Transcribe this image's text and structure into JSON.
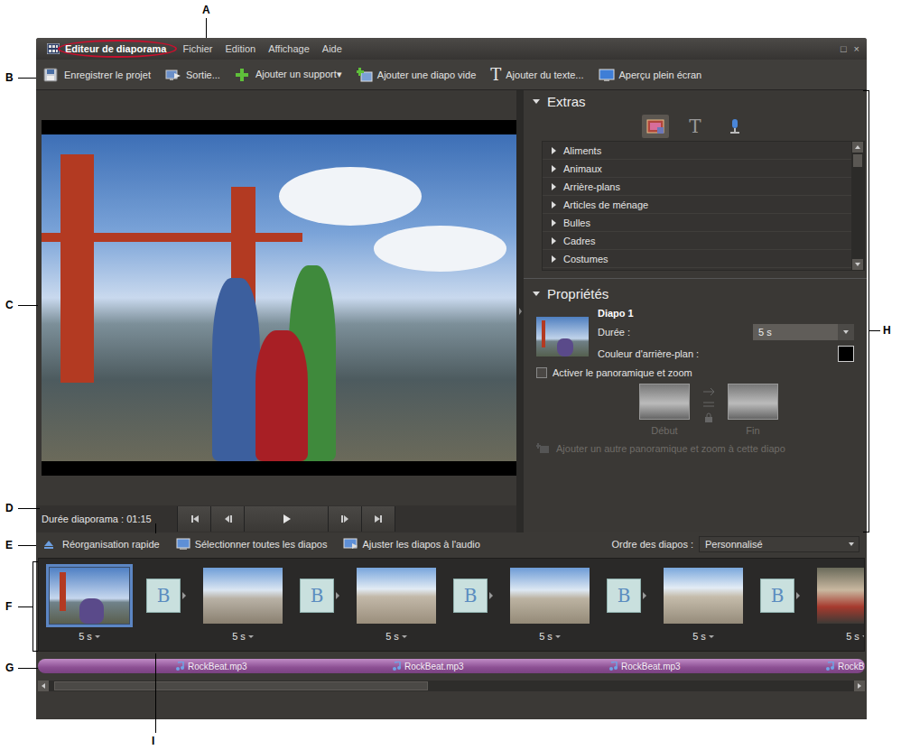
{
  "callouts": [
    {
      "letter": "A"
    },
    {
      "letter": "B"
    },
    {
      "letter": "C"
    },
    {
      "letter": "D"
    },
    {
      "letter": "E"
    },
    {
      "letter": "F"
    },
    {
      "letter": "G"
    },
    {
      "letter": "H"
    },
    {
      "letter": "I"
    }
  ],
  "window": {
    "title": "Editeur de diaporama",
    "controls": [
      "□",
      "×"
    ]
  },
  "menu": [
    "Fichier",
    "Edition",
    "Affichage",
    "Aide"
  ],
  "toolbar": [
    {
      "label": "Enregistrer le projet",
      "kind": "save"
    },
    {
      "label": "Sortie...",
      "kind": "output"
    },
    {
      "label": "Ajouter un support▾",
      "kind": "add"
    },
    {
      "label": "Ajouter une diapo vide",
      "kind": "blank"
    },
    {
      "label": "Ajouter du texte...",
      "kind": "text",
      "glyph": "T"
    },
    {
      "label": "Aperçu plein écran",
      "kind": "fullscreen"
    }
  ],
  "preview": {
    "duration": "Durée diaporama : 01:15"
  },
  "extras": {
    "title": "Extras",
    "tabs": [
      {
        "kind": "graphics",
        "selected": true
      },
      {
        "kind": "text",
        "glyph": "T",
        "selected": false
      },
      {
        "kind": "narration",
        "selected": false
      }
    ],
    "categories": [
      "Aliments",
      "Animaux",
      "Arrière-plans",
      "Articles de ménage",
      "Bulles",
      "Cadres",
      "Costumes"
    ]
  },
  "properties": {
    "title": "Propriétés",
    "slide": "Diapo 1",
    "duration_label": "Durée :",
    "duration": "5 s",
    "background_label": "Couleur d'arrière-plan :",
    "pan_zoom": {
      "label": "Activer le panoramique et zoom",
      "checked": false,
      "start": "Début",
      "end": "Fin",
      "add": "Ajouter un autre panoramique et zoom à cette diapo",
      "disabled": true
    }
  },
  "arrange_bar": {
    "items": [
      {
        "label": "Réorganisation rapide",
        "kind": "reorder"
      },
      {
        "label": "Sélectionner toutes les diapos",
        "kind": "select"
      },
      {
        "label": "Ajuster les diapos à l'audio",
        "kind": "fit"
      }
    ],
    "order_label": "Ordre des diapos :",
    "order": "Personnalisé"
  },
  "filmstrip": {
    "slides": [
      {
        "duration": "5 s",
        "selected": true
      },
      {
        "duration": "5 s",
        "selected": false
      },
      {
        "duration": "5 s",
        "selected": false
      },
      {
        "duration": "5 s",
        "selected": false
      },
      {
        "duration": "5 s",
        "selected": false
      },
      {
        "duration": "5 s",
        "selected": false
      }
    ],
    "transitions": [
      {
        "label": "B"
      },
      {
        "label": "B"
      },
      {
        "label": "B"
      },
      {
        "label": "B"
      },
      {
        "label": "B"
      }
    ]
  },
  "audio": {
    "clips": [
      "RockBeat.mp3",
      "RockBeat.mp3",
      "RockBeat.mp3",
      "RockB"
    ]
  }
}
